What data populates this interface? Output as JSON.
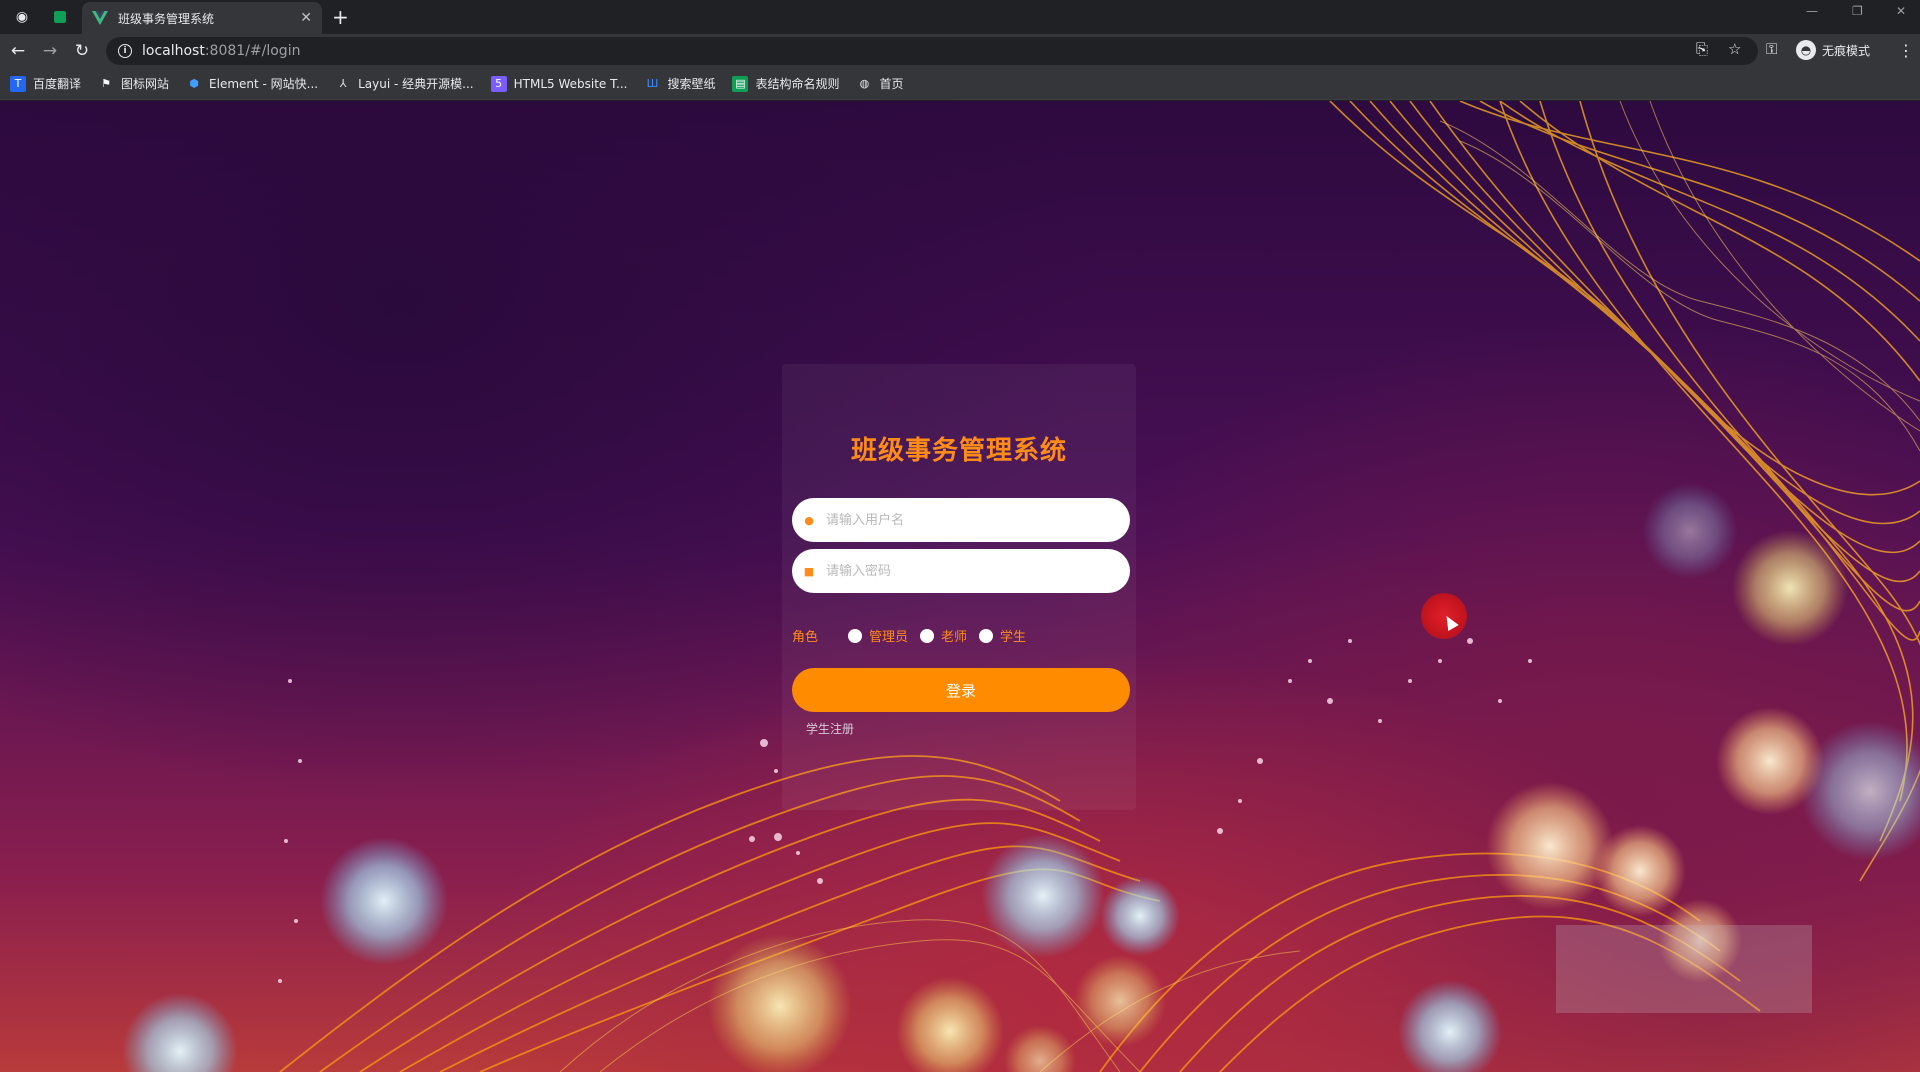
{
  "browser": {
    "tab_title": "班级事务管理系统",
    "url_host": "localhost",
    "url_rest": ":8081/#/login",
    "profile_label": "无痕模式",
    "bookmarks": [
      {
        "label": "百度翻译",
        "icon": "baidu-translate-icon",
        "color": "#2468f2"
      },
      {
        "label": "图标网站",
        "icon": "flag-icon",
        "color": "#ffffff"
      },
      {
        "label": "Element - 网站快...",
        "icon": "element-icon",
        "color": "#409eff"
      },
      {
        "label": "Layui - 经典开源模...",
        "icon": "layui-icon",
        "color": "#dddddd"
      },
      {
        "label": "HTML5 Website T...",
        "icon": "html5-icon",
        "color": "#7b5cff"
      },
      {
        "label": "搜索壁纸",
        "icon": "wallpaper-icon",
        "color": "#3d8bfd"
      },
      {
        "label": "表结构命名规则",
        "icon": "sheet-icon",
        "color": "#0f9d58"
      },
      {
        "label": "首页",
        "icon": "globe-icon",
        "color": "#e8eaed"
      }
    ]
  },
  "login": {
    "title": "班级事务管理系统",
    "username_placeholder": "请输入用户名",
    "password_placeholder": "请输入密码",
    "role_label": "角色",
    "roles": [
      "管理员",
      "老师",
      "学生"
    ],
    "login_button": "登录",
    "register_link": "学生注册"
  },
  "colors": {
    "accent": "#ff8c1a",
    "button": "#ff8c00",
    "tab_bg": "#35363a",
    "chrome_bg": "#202124"
  }
}
